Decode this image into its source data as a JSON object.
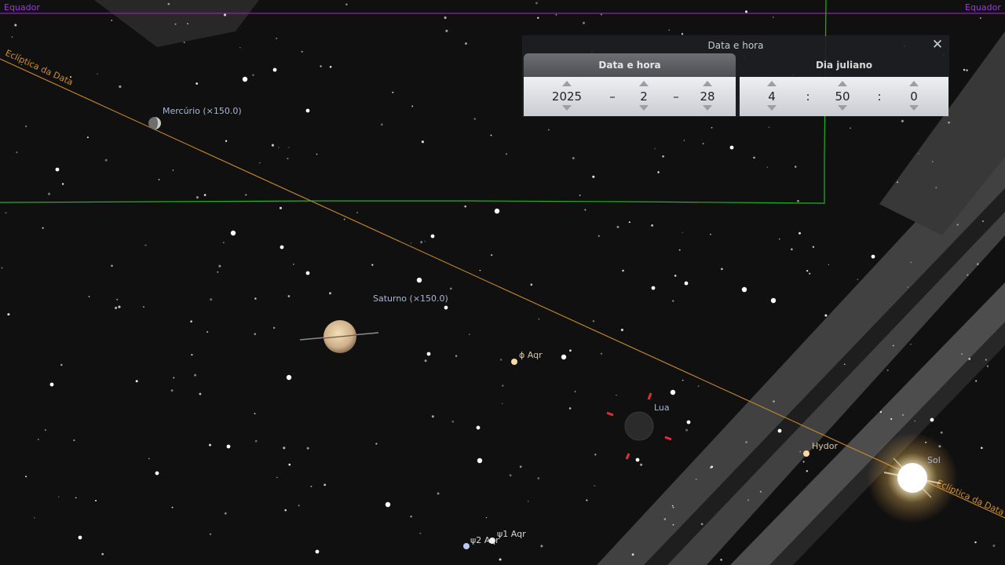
{
  "sky": {
    "equator_label_left": "Equador",
    "equator_label_right": "Equador",
    "ecliptic_label_left": "Eclíptica da Data",
    "ecliptic_label_right": "Eclíptica da Data",
    "objects": {
      "mercury": "Mercúrio  (×150.0)",
      "saturn": "Saturno (×150.0)",
      "moon": "Lua",
      "sun": "Sol",
      "phi_aqr": "ϕ Aqr",
      "hydor": "Hydor",
      "psi1_aqr": "ψ1 Aqr",
      "psi2_aqr": "ψ2 Aqr"
    },
    "colors": {
      "equator": "#8a1fbf",
      "ecliptic": "#c88a2a",
      "boundary": "#1fb41f",
      "label": "#a9b6d6"
    }
  },
  "dialog": {
    "title": "Data e hora",
    "close_icon": "close-icon",
    "tabs": [
      "Data e hora",
      "Dia juliano"
    ],
    "date": {
      "year": "2025",
      "month": "2",
      "day": "28",
      "separator": "–"
    },
    "time": {
      "hour": "4",
      "minute": "50",
      "second": "0",
      "separator": ":"
    }
  }
}
